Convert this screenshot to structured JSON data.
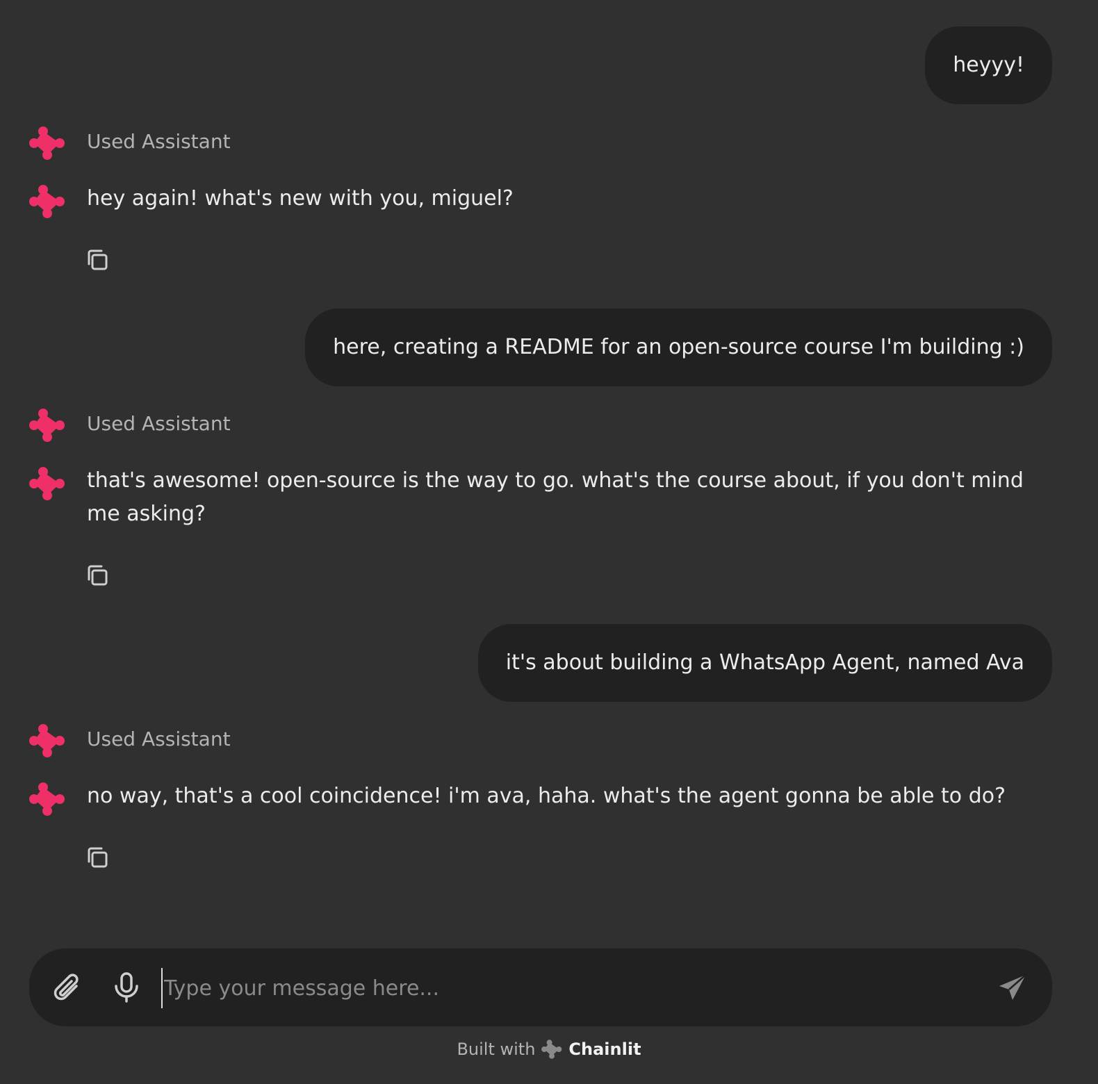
{
  "messages": [
    {
      "role": "user",
      "text": "heyyy!"
    },
    {
      "role": "assistant",
      "step_label": "Used Assistant",
      "text": "hey again! what's new with you, miguel?"
    },
    {
      "role": "user",
      "text": "here, creating a README for an open-source course I'm building :)"
    },
    {
      "role": "assistant",
      "step_label": "Used Assistant",
      "text": "that's awesome! open-source is the way to go. what's the course about, if you don't mind me asking?"
    },
    {
      "role": "user",
      "text": "it's about building a WhatsApp Agent, named Ava"
    },
    {
      "role": "assistant",
      "step_label": "Used Assistant",
      "text": "no way, that's a cool coincidence! i'm ava, haha. what's the agent gonna be able to do?"
    }
  ],
  "composer": {
    "placeholder": "Type your message here...",
    "value": "",
    "icons": {
      "attach": "paperclip-icon",
      "mic": "microphone-icon",
      "send": "send-icon"
    }
  },
  "footer": {
    "built_with": "Built with",
    "brand": "Chainlit"
  },
  "colors": {
    "background": "#303030",
    "bubble": "#212121",
    "accent": "#EF2F67",
    "text": "#ECECEC",
    "muted": "#B4B4B4"
  },
  "icons": {
    "avatar": "chainlit-logo-icon",
    "copy": "copy-icon"
  }
}
